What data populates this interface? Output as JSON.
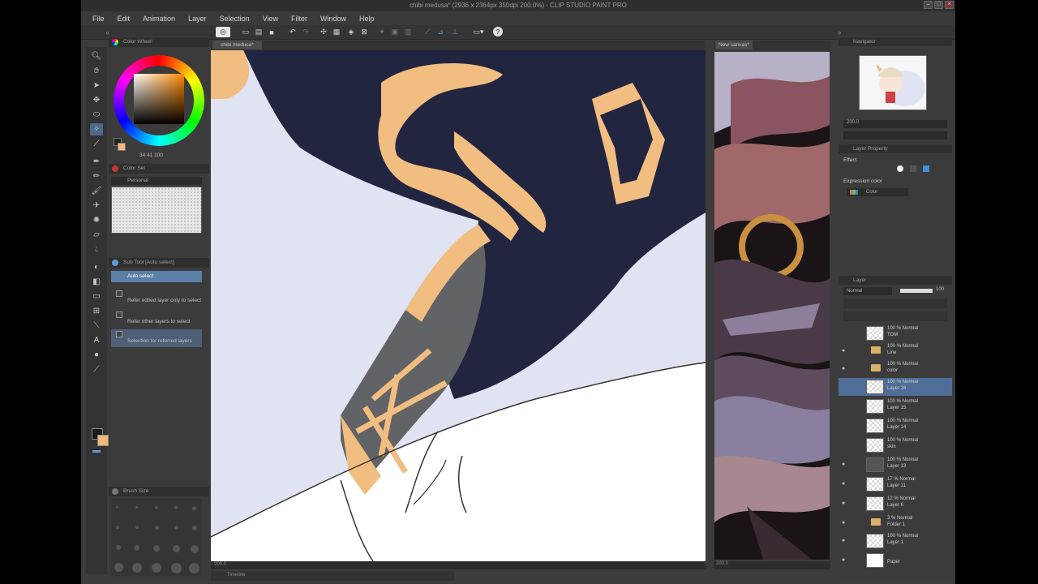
{
  "window": {
    "title": "chibi medusa* (2936 x 2364px 350dpi 200.0%) - CLIP STUDIO PAINT PRO"
  },
  "menu": [
    "File",
    "Edit",
    "Animation",
    "Layer",
    "Selection",
    "View",
    "Filter",
    "Window",
    "Help"
  ],
  "panels": {
    "color_wheel": {
      "title": "Color Wheel",
      "readout": "34  41  100"
    },
    "color_set": {
      "title": "Color Set",
      "set_name": "Personal"
    },
    "sub_tool": {
      "title": "Sub Tool [Auto select]",
      "selected": "Auto select",
      "options": [
        "Refer edited layer only to select",
        "Refer other layers to select",
        "Selection for referred layers"
      ]
    },
    "brush_size": {
      "title": "Brush Size"
    }
  },
  "canvas": {
    "tab": "chibi medusa*",
    "zoom": "200.0",
    "reference_tab": "New canvas*",
    "reference_zoom": "200.0"
  },
  "navigator": {
    "title": "Navigator",
    "zoom": "200.0"
  },
  "layer_property": {
    "title": "Layer Property",
    "effect_label": "Effect",
    "expression_color_label": "Expression color",
    "expression_color_value": "Color"
  },
  "layers": {
    "title": "Layer",
    "blend_mode": "Normal",
    "opacity": "100",
    "items": [
      {
        "mode": "100 % Normal",
        "name": "TOM"
      },
      {
        "mode": "100 % Normal",
        "name": "Line"
      },
      {
        "mode": "100 % Normal",
        "name": "color"
      },
      {
        "mode": "100 % Normal",
        "name": "Layer 16"
      },
      {
        "mode": "100 % Normal",
        "name": "Layer 15"
      },
      {
        "mode": "100 % Normal",
        "name": "Layer 14"
      },
      {
        "mode": "100 % Normal",
        "name": "skin"
      },
      {
        "mode": "100 % Normal",
        "name": "Layer 13"
      },
      {
        "mode": "17 % Normal",
        "name": "Layer 11"
      },
      {
        "mode": "12 % Normal",
        "name": "Layer 6"
      },
      {
        "mode": "3 % Normal",
        "name": "Folder 1"
      },
      {
        "mode": "100 % Normal",
        "name": "Layer 1"
      },
      {
        "mode": "",
        "name": "Paper"
      }
    ]
  },
  "timeline": {
    "title": "Timeline"
  },
  "colors": {
    "main_color": "#1a1a1a",
    "sub_color": "#f4b979",
    "accent": "#5b7fa6"
  }
}
